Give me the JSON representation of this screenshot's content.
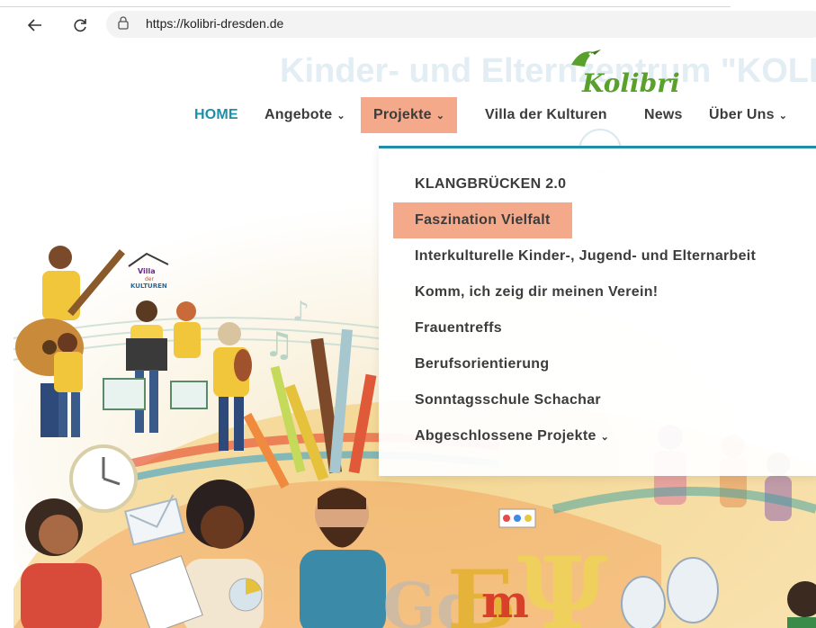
{
  "browser": {
    "url": "https://kolibri-dresden.de",
    "back_icon": "arrow-left-icon",
    "reload_icon": "reload-icon",
    "lock_icon": "lock-icon"
  },
  "site": {
    "ghost_title": "Kinder- und Elternzentrum \"KOLIBRI",
    "logo_text": "Kolibri",
    "villa_logo": [
      "Villa",
      "der",
      "KULTUREN"
    ]
  },
  "nav": {
    "home": "HOME",
    "angebote": "Angebote",
    "projekte": "Projekte",
    "villa": "Villa der Kulturen",
    "news": "News",
    "ueber_uns": "Über Uns",
    "chevron": "⌄"
  },
  "dropdown": {
    "items": [
      "KLANGBRÜCKEN 2.0",
      "Faszination Vielfalt",
      "Interkulturelle Kinder-, Jugend- und Elternarbeit",
      "Komm, ich zeig dir meinen Verein!",
      "Frauentreffs",
      "Berufsorientierung",
      "Sonntagsschule Schachar",
      "Abgeschlossene Projekte"
    ]
  },
  "colors": {
    "accent": "#1d8fa8",
    "highlight": "#f4a98a",
    "text": "#3c3c3c"
  }
}
